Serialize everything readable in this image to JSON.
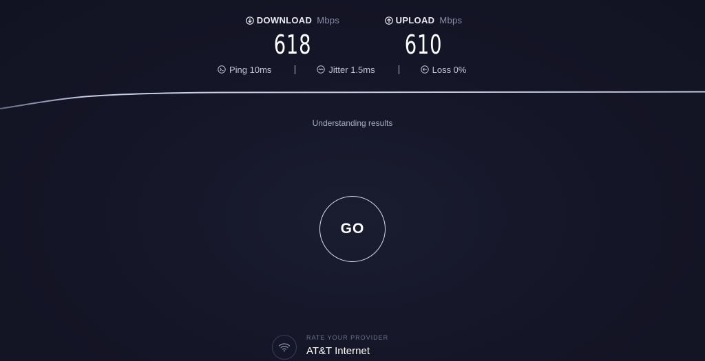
{
  "download": {
    "label": "DOWNLOAD",
    "unit": "Mbps",
    "value": "618",
    "icon": "download-arrow-icon"
  },
  "upload": {
    "label": "UPLOAD",
    "unit": "Mbps",
    "value": "610",
    "icon": "upload-arrow-icon"
  },
  "stats": {
    "ping": "Ping 10ms",
    "jitter": "Jitter 1.5ms",
    "loss": "Loss 0%"
  },
  "status_text": "Understanding results",
  "go_label": "GO",
  "provider": {
    "caption": "RATE YOUR PROVIDER",
    "name": "AT&T Internet",
    "icon": "wifi-icon"
  },
  "colors": {
    "background": "#141526",
    "graph_line": "#c9cde4",
    "accent_text": "#8b8ea8"
  }
}
